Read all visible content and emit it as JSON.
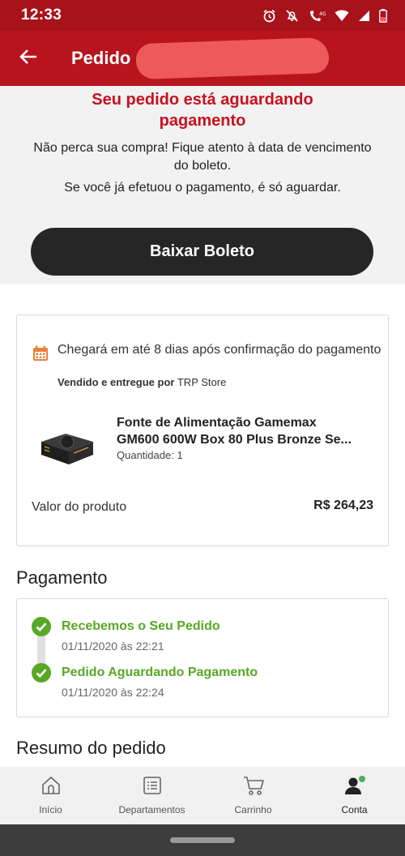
{
  "status_bar": {
    "time": "12:33",
    "network_label": "4G"
  },
  "app_bar": {
    "title": "Pedido n° 12"
  },
  "pending": {
    "title": "Seu pedido está aguardando pagamento",
    "message_1": "Não perca sua compra! Fique atento à data de vencimento do boleto.",
    "message_2": "Se você já efetuou o pagamento, é só aguardar.",
    "download_button": "Baixar Boleto"
  },
  "order": {
    "delivery_text": "Chegará em até 8 dias após confirmação do pagamento",
    "seller_prefix": "Vendido e entregue por",
    "seller_name": "TRP Store",
    "product_name_line1": "Fonte de Alimentação Gamemax",
    "product_name_line2": "GM600 600W Box 80 Plus Bronze Se...",
    "quantity": "Quantidade: 1",
    "value_label": "Valor do produto",
    "value_amount": "R$ 264,23"
  },
  "payment": {
    "heading": "Pagamento",
    "steps": [
      {
        "title": "Recebemos o Seu Pedido",
        "date": "01/11/2020 às 22:21"
      },
      {
        "title": "Pedido Aguardando Pagamento",
        "date": "01/11/2020 às 22:24"
      }
    ]
  },
  "summary": {
    "heading": "Resumo do pedido"
  },
  "nav": [
    {
      "label": "Início",
      "icon": "home-icon"
    },
    {
      "label": "Departamentos",
      "icon": "list-icon"
    },
    {
      "label": "Carrinho",
      "icon": "cart-icon"
    },
    {
      "label": "Conta",
      "icon": "account-icon"
    }
  ],
  "colors": {
    "brand_red": "#b8141e",
    "alert_red": "#c8101f",
    "success_green": "#58a825",
    "button_dark": "#262626",
    "calendar_orange": "#e8803a",
    "notification_dot": "#4caf50"
  }
}
